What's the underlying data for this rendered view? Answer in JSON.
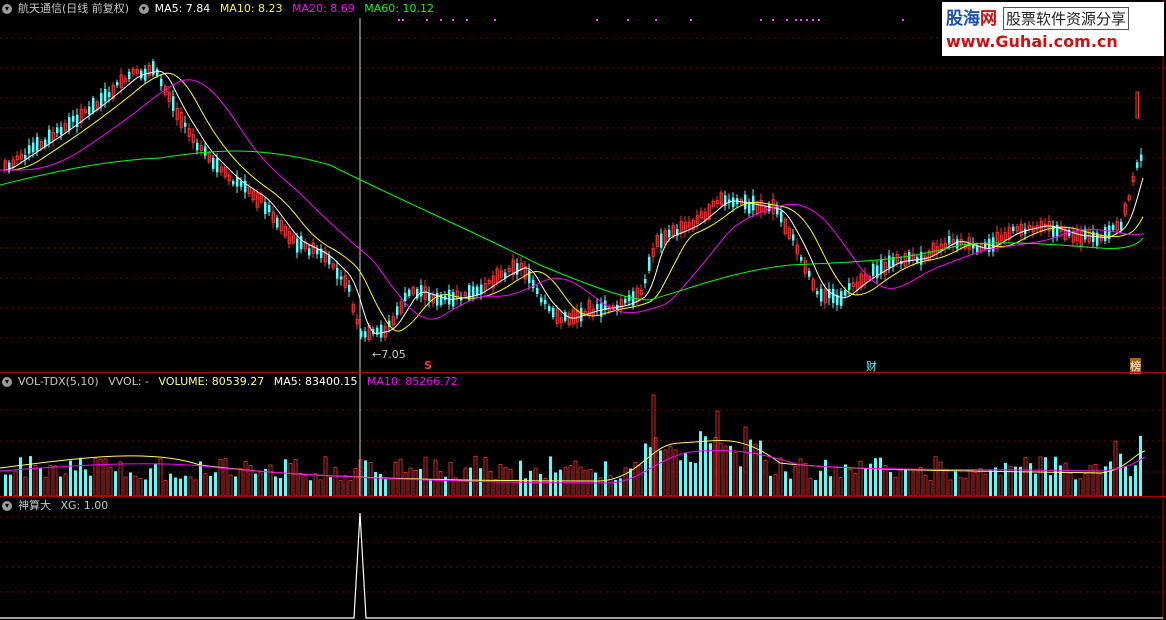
{
  "main": {
    "collapse_icon": "chevron-down-icon",
    "stock_title": "航天通信(日线 前复权)",
    "ma5": "MA5: 7.84",
    "ma10": "MA10: 8.23",
    "ma20": "MA20: 8.69",
    "ma60": "MA60: 10.12",
    "low_label": "7.05",
    "marker_s": "S",
    "marker_cai": "财",
    "marker_bang": "榜",
    "colors": {
      "ma5": "#ffffff",
      "ma10": "#ffff00",
      "ma20": "#ff00ff",
      "ma60": "#00ff00",
      "up": "#ff3232",
      "down": "#54ffff"
    }
  },
  "watermark": {
    "brand_a": "股海",
    "brand_b": "网",
    "slogan": "股票软件资源分享",
    "url": "www.Guhai.com.cn"
  },
  "volume": {
    "title": "VOL-TDX(5,10)",
    "vvol": "VVOL: -",
    "volume": "VOLUME: 80539.27",
    "ma5": "MA5: 83400.15",
    "ma10": "MA10: 85266.72"
  },
  "indicator": {
    "title": "神算大",
    "xg": "XG: 1.00"
  }
}
